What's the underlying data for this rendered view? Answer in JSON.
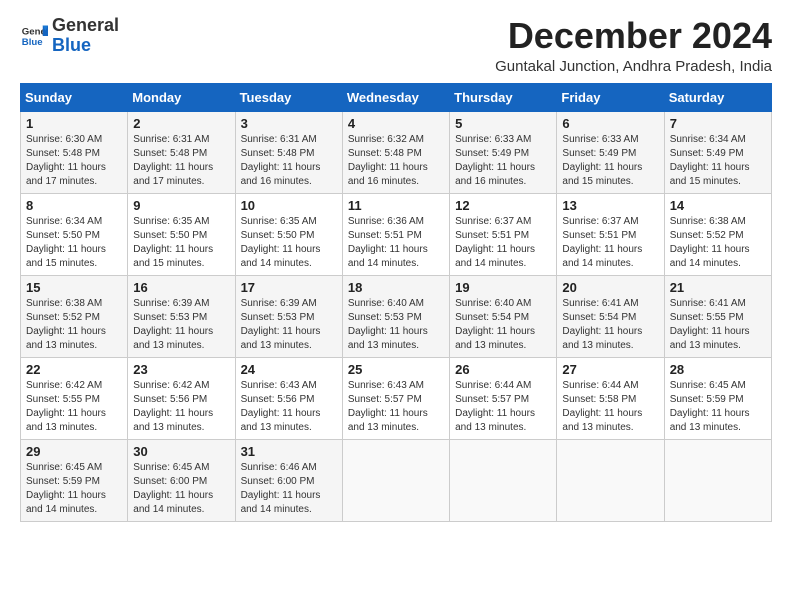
{
  "logo": {
    "general": "General",
    "blue": "Blue"
  },
  "header": {
    "title": "December 2024",
    "subtitle": "Guntakal Junction, Andhra Pradesh, India"
  },
  "calendar": {
    "weekdays": [
      "Sunday",
      "Monday",
      "Tuesday",
      "Wednesday",
      "Thursday",
      "Friday",
      "Saturday"
    ],
    "rows": [
      [
        {
          "day": "1",
          "info": "Sunrise: 6:30 AM\nSunset: 5:48 PM\nDaylight: 11 hours\nand 17 minutes."
        },
        {
          "day": "2",
          "info": "Sunrise: 6:31 AM\nSunset: 5:48 PM\nDaylight: 11 hours\nand 17 minutes."
        },
        {
          "day": "3",
          "info": "Sunrise: 6:31 AM\nSunset: 5:48 PM\nDaylight: 11 hours\nand 16 minutes."
        },
        {
          "day": "4",
          "info": "Sunrise: 6:32 AM\nSunset: 5:48 PM\nDaylight: 11 hours\nand 16 minutes."
        },
        {
          "day": "5",
          "info": "Sunrise: 6:33 AM\nSunset: 5:49 PM\nDaylight: 11 hours\nand 16 minutes."
        },
        {
          "day": "6",
          "info": "Sunrise: 6:33 AM\nSunset: 5:49 PM\nDaylight: 11 hours\nand 15 minutes."
        },
        {
          "day": "7",
          "info": "Sunrise: 6:34 AM\nSunset: 5:49 PM\nDaylight: 11 hours\nand 15 minutes."
        }
      ],
      [
        {
          "day": "8",
          "info": "Sunrise: 6:34 AM\nSunset: 5:50 PM\nDaylight: 11 hours\nand 15 minutes."
        },
        {
          "day": "9",
          "info": "Sunrise: 6:35 AM\nSunset: 5:50 PM\nDaylight: 11 hours\nand 15 minutes."
        },
        {
          "day": "10",
          "info": "Sunrise: 6:35 AM\nSunset: 5:50 PM\nDaylight: 11 hours\nand 14 minutes."
        },
        {
          "day": "11",
          "info": "Sunrise: 6:36 AM\nSunset: 5:51 PM\nDaylight: 11 hours\nand 14 minutes."
        },
        {
          "day": "12",
          "info": "Sunrise: 6:37 AM\nSunset: 5:51 PM\nDaylight: 11 hours\nand 14 minutes."
        },
        {
          "day": "13",
          "info": "Sunrise: 6:37 AM\nSunset: 5:51 PM\nDaylight: 11 hours\nand 14 minutes."
        },
        {
          "day": "14",
          "info": "Sunrise: 6:38 AM\nSunset: 5:52 PM\nDaylight: 11 hours\nand 14 minutes."
        }
      ],
      [
        {
          "day": "15",
          "info": "Sunrise: 6:38 AM\nSunset: 5:52 PM\nDaylight: 11 hours\nand 13 minutes."
        },
        {
          "day": "16",
          "info": "Sunrise: 6:39 AM\nSunset: 5:53 PM\nDaylight: 11 hours\nand 13 minutes."
        },
        {
          "day": "17",
          "info": "Sunrise: 6:39 AM\nSunset: 5:53 PM\nDaylight: 11 hours\nand 13 minutes."
        },
        {
          "day": "18",
          "info": "Sunrise: 6:40 AM\nSunset: 5:53 PM\nDaylight: 11 hours\nand 13 minutes."
        },
        {
          "day": "19",
          "info": "Sunrise: 6:40 AM\nSunset: 5:54 PM\nDaylight: 11 hours\nand 13 minutes."
        },
        {
          "day": "20",
          "info": "Sunrise: 6:41 AM\nSunset: 5:54 PM\nDaylight: 11 hours\nand 13 minutes."
        },
        {
          "day": "21",
          "info": "Sunrise: 6:41 AM\nSunset: 5:55 PM\nDaylight: 11 hours\nand 13 minutes."
        }
      ],
      [
        {
          "day": "22",
          "info": "Sunrise: 6:42 AM\nSunset: 5:55 PM\nDaylight: 11 hours\nand 13 minutes."
        },
        {
          "day": "23",
          "info": "Sunrise: 6:42 AM\nSunset: 5:56 PM\nDaylight: 11 hours\nand 13 minutes."
        },
        {
          "day": "24",
          "info": "Sunrise: 6:43 AM\nSunset: 5:56 PM\nDaylight: 11 hours\nand 13 minutes."
        },
        {
          "day": "25",
          "info": "Sunrise: 6:43 AM\nSunset: 5:57 PM\nDaylight: 11 hours\nand 13 minutes."
        },
        {
          "day": "26",
          "info": "Sunrise: 6:44 AM\nSunset: 5:57 PM\nDaylight: 11 hours\nand 13 minutes."
        },
        {
          "day": "27",
          "info": "Sunrise: 6:44 AM\nSunset: 5:58 PM\nDaylight: 11 hours\nand 13 minutes."
        },
        {
          "day": "28",
          "info": "Sunrise: 6:45 AM\nSunset: 5:59 PM\nDaylight: 11 hours\nand 13 minutes."
        }
      ],
      [
        {
          "day": "29",
          "info": "Sunrise: 6:45 AM\nSunset: 5:59 PM\nDaylight: 11 hours\nand 14 minutes."
        },
        {
          "day": "30",
          "info": "Sunrise: 6:45 AM\nSunset: 6:00 PM\nDaylight: 11 hours\nand 14 minutes."
        },
        {
          "day": "31",
          "info": "Sunrise: 6:46 AM\nSunset: 6:00 PM\nDaylight: 11 hours\nand 14 minutes."
        },
        null,
        null,
        null,
        null
      ]
    ]
  }
}
